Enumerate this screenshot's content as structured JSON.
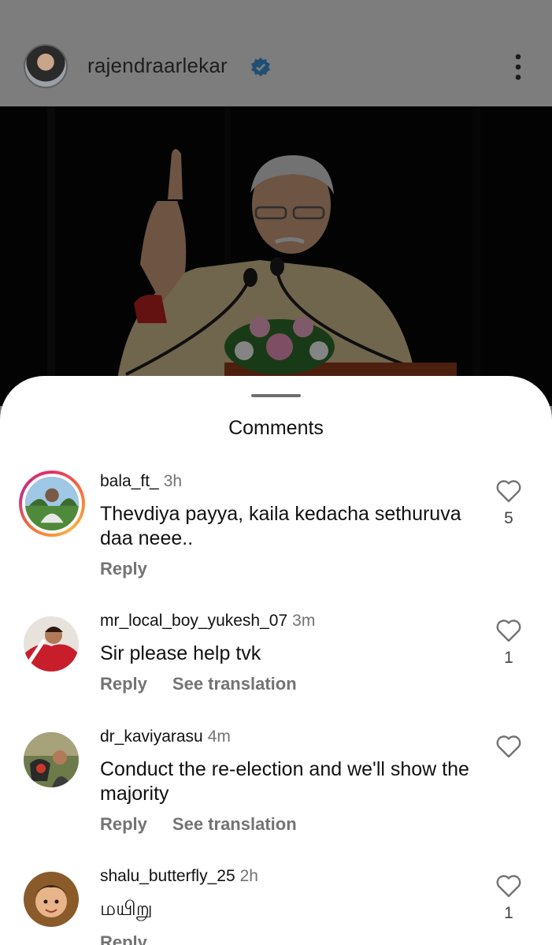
{
  "post": {
    "username": "rajendraarlekar",
    "verified_icon": "verified-badge-icon",
    "more_icon": "more-vertical-icon"
  },
  "sheet": {
    "title": "Comments"
  },
  "comments": [
    {
      "username": "bala_ft_",
      "time": "3h",
      "text": "Thevdiya payya, kaila kedacha sethuruva daa neee..",
      "reply_label": "Reply",
      "like_count": "5"
    },
    {
      "username": "mr_local_boy_yukesh_07",
      "time": "3m",
      "text": "Sir please help tvk",
      "reply_label": "Reply",
      "translate_label": "See translation",
      "like_count": "1"
    },
    {
      "username": "dr_kaviyarasu",
      "time": "4m",
      "text": "Conduct the re-election and we'll show the majority",
      "reply_label": "Reply",
      "translate_label": "See translation",
      "like_count": ""
    },
    {
      "username": "shalu_butterfly_25",
      "time": "2h",
      "text": "மயிறு",
      "reply_label": "Reply",
      "like_count": "1"
    }
  ],
  "colors": {
    "overlay": "#7d7d7d",
    "verified": "#0095f6",
    "secondary_text": "#737373"
  }
}
